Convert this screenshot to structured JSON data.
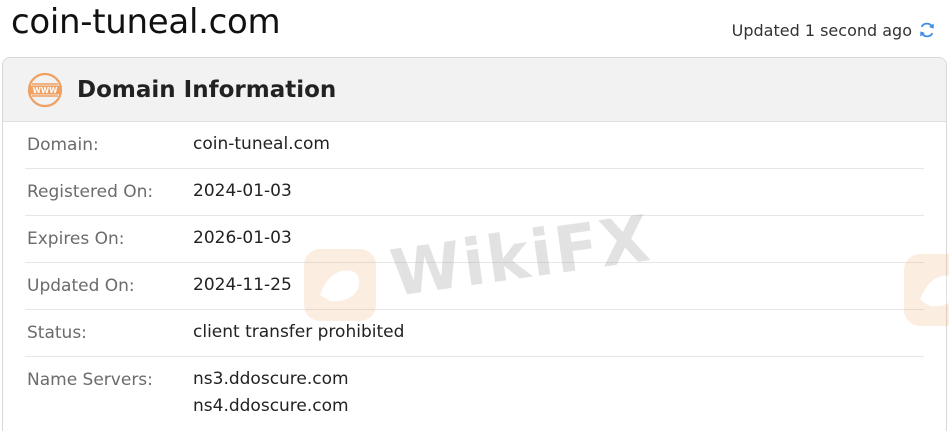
{
  "page": {
    "title": "coin-tuneal.com",
    "updated_text": "Updated 1 second ago"
  },
  "card": {
    "title": "Domain Information",
    "rows": [
      {
        "label": "Domain:",
        "values": [
          "coin-tuneal.com"
        ]
      },
      {
        "label": "Registered On:",
        "values": [
          "2024-01-03"
        ]
      },
      {
        "label": "Expires On:",
        "values": [
          "2026-01-03"
        ]
      },
      {
        "label": "Updated On:",
        "values": [
          "2024-11-25"
        ]
      },
      {
        "label": "Status:",
        "values": [
          "client transfer prohibited"
        ]
      },
      {
        "label": "Name Servers:",
        "values": [
          "ns3.ddoscure.com",
          "ns4.ddoscure.com"
        ]
      }
    ]
  },
  "watermark": {
    "text": "WikiFX"
  },
  "colors": {
    "accent_orange": "#f0a060",
    "refresh_blue": "#3a8ee6"
  }
}
